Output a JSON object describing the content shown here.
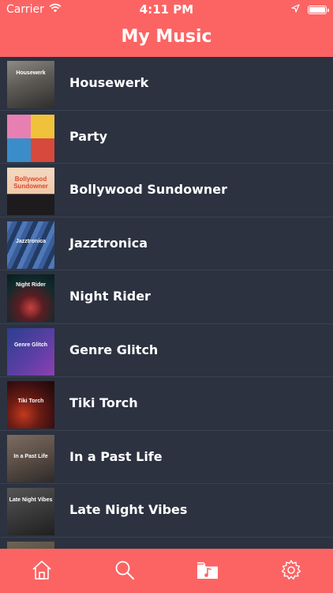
{
  "status_bar": {
    "carrier": "Carrier",
    "time": "4:11 PM",
    "wifi_icon": "wifi-icon",
    "location_icon": "location-arrow-icon",
    "battery_icon": "battery-icon"
  },
  "header": {
    "title": "My Music"
  },
  "playlists": [
    {
      "label": "Housewerk",
      "thumb_text": "Housewerk",
      "colors": [
        "#8e8b86",
        "#3d3b3a"
      ]
    },
    {
      "label": "Party",
      "thumb_text": "",
      "colors": [
        "#f0c23b",
        "#d7493d"
      ]
    },
    {
      "label": "Bollywood Sundowner",
      "thumb_text": "Bollywood Sundowner",
      "colors": [
        "#f2d9c2",
        "#1e1b1e"
      ]
    },
    {
      "label": "Jazztronica",
      "thumb_text": "Jazztronica",
      "colors": [
        "#4f78b8",
        "#233b63"
      ]
    },
    {
      "label": "Night Rider",
      "thumb_text": "Night Rider",
      "colors": [
        "#0f2b2c",
        "#c94140"
      ]
    },
    {
      "label": "Genre Glitch",
      "thumb_text": "Genre Glitch",
      "colors": [
        "#2b3f8f",
        "#8e3fb0"
      ]
    },
    {
      "label": "Tiki Torch",
      "thumb_text": "Tiki Torch",
      "colors": [
        "#3a0f10",
        "#c23a1e"
      ]
    },
    {
      "label": "In a Past Life",
      "thumb_text": "In a Past Life",
      "colors": [
        "#7b6c60",
        "#2e2a28"
      ]
    },
    {
      "label": "Late Night Vibes",
      "thumb_text": "Late Night Vibes",
      "colors": [
        "#555555",
        "#1f1f1f"
      ]
    }
  ],
  "tabbar": {
    "accent": "#fc6464",
    "tabs": [
      {
        "icon": "home-icon"
      },
      {
        "icon": "search-icon"
      },
      {
        "icon": "music-folder-icon"
      },
      {
        "icon": "gear-icon"
      }
    ]
  },
  "colors": {
    "header": "#fc6464",
    "background": "#2c3240",
    "divider": "#394151"
  }
}
